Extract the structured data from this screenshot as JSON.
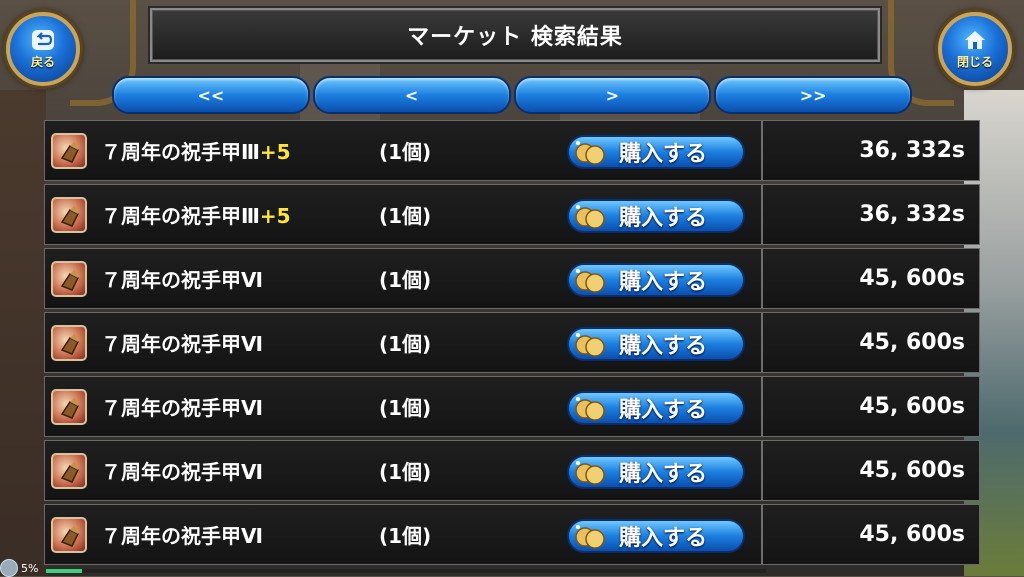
{
  "header": {
    "title": "マーケット 検索結果"
  },
  "back_button": {
    "label": "戻る",
    "icon": "back-arrow-icon"
  },
  "close_button": {
    "label": "閉じる",
    "icon": "home-icon"
  },
  "pager": {
    "first": "<<",
    "prev": "<",
    "next": ">",
    "last": ">>"
  },
  "rows": [
    {
      "name": "７周年の祝手甲Ⅲ",
      "plus": "+5",
      "qty": "(1個)",
      "buy_label": "購入する",
      "price": "36, 332s"
    },
    {
      "name": "７周年の祝手甲Ⅲ",
      "plus": "+5",
      "qty": "(1個)",
      "buy_label": "購入する",
      "price": "36, 332s"
    },
    {
      "name": "７周年の祝手甲Ⅵ",
      "plus": "",
      "qty": "(1個)",
      "buy_label": "購入する",
      "price": "45, 600s"
    },
    {
      "name": "７周年の祝手甲Ⅵ",
      "plus": "",
      "qty": "(1個)",
      "buy_label": "購入する",
      "price": "45, 600s"
    },
    {
      "name": "７周年の祝手甲Ⅵ",
      "plus": "",
      "qty": "(1個)",
      "buy_label": "購入する",
      "price": "45, 600s"
    },
    {
      "name": "７周年の祝手甲Ⅵ",
      "plus": "",
      "qty": "(1個)",
      "buy_label": "購入する",
      "price": "45, 600s"
    },
    {
      "name": "７周年の祝手甲Ⅵ",
      "plus": "",
      "qty": "(1個)",
      "buy_label": "購入する",
      "price": "45, 600s"
    }
  ],
  "status": {
    "text": "5%",
    "progress": 0.05
  },
  "colors": {
    "accent": "#1c7fe0",
    "plus": "#ffe53a",
    "frame_gold": "#c9a55a"
  }
}
